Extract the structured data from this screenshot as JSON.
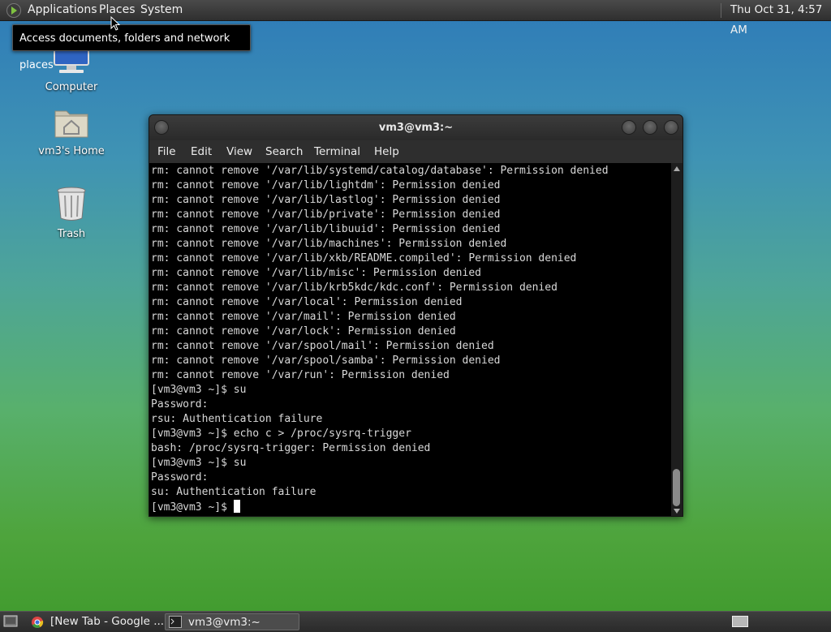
{
  "top_panel": {
    "menus": [
      "Applications",
      "Places",
      "System"
    ],
    "clock": "Thu Oct 31,  4:57 AM"
  },
  "tooltip": "Access documents, folders and network places",
  "desktop": {
    "icons": [
      {
        "label": "Computer",
        "icon": "computer-icon"
      },
      {
        "label": "vm3's Home",
        "icon": "home-folder-icon"
      },
      {
        "label": "Trash",
        "icon": "trash-icon"
      }
    ]
  },
  "terminal": {
    "title": "vm3@vm3:~",
    "menu": [
      "File",
      "Edit",
      "View",
      "Search",
      "Terminal",
      "Help"
    ],
    "lines": [
      "rm: cannot remove '/var/lib/systemd/catalog/database': Permission denied",
      "rm: cannot remove '/var/lib/lightdm': Permission denied",
      "rm: cannot remove '/var/lib/lastlog': Permission denied",
      "rm: cannot remove '/var/lib/private': Permission denied",
      "rm: cannot remove '/var/lib/libuuid': Permission denied",
      "rm: cannot remove '/var/lib/machines': Permission denied",
      "rm: cannot remove '/var/lib/xkb/README.compiled': Permission denied",
      "rm: cannot remove '/var/lib/misc': Permission denied",
      "rm: cannot remove '/var/lib/krb5kdc/kdc.conf': Permission denied",
      "rm: cannot remove '/var/local': Permission denied",
      "rm: cannot remove '/var/mail': Permission denied",
      "rm: cannot remove '/var/lock': Permission denied",
      "rm: cannot remove '/var/spool/mail': Permission denied",
      "rm: cannot remove '/var/spool/samba': Permission denied",
      "rm: cannot remove '/var/run': Permission denied",
      "[vm3@vm3 ~]$ su",
      "Password:",
      "rsu: Authentication failure",
      "[vm3@vm3 ~]$ echo c > /proc/sysrq-trigger",
      "bash: /proc/sysrq-trigger: Permission denied",
      "[vm3@vm3 ~]$ su",
      "Password:",
      "su: Authentication failure"
    ],
    "prompt": "[vm3@vm3 ~]$ "
  },
  "taskbar": {
    "tasks": [
      {
        "label": "[New Tab - Google ...",
        "icon": "chrome-icon"
      },
      {
        "label": "vm3@vm3:~",
        "icon": "terminal-icon"
      }
    ]
  }
}
